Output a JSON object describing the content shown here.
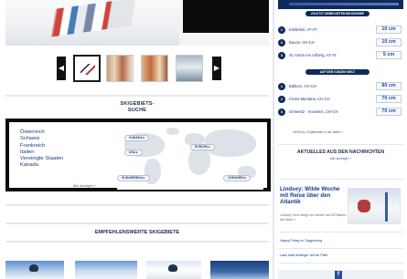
{
  "carousel": {
    "prev_label": "◀",
    "next_label": "▶"
  },
  "ski_search": {
    "title_line1": "SKIGEBIETS-",
    "title_line2": "SUCHE",
    "countries": [
      "Österreich",
      "Schweiz",
      "Frankreich",
      "Italien",
      "Vereinigte Staaten",
      "Kanada"
    ],
    "show_all": "Alle anzeigen »",
    "regions": {
      "kanada": "KANADA ▸",
      "usa": "USA ▸",
      "europa": "EUROPA ▸",
      "suedamerika": "SÜDAMERIKA ▸",
      "ozeanien": "OZEANIEN ▸"
    }
  },
  "recommended": {
    "title": "EMPFEHLENSWERTE SKIGEBIETE"
  },
  "snow_ranking": {
    "section1_title": "ZULETZT GEMELDETER NEUSCHNEE",
    "section2_title": "AUF DEM GANZEN WELT",
    "rows": [
      {
        "rank": "1",
        "name": "Kitzbühel, AT-AT",
        "value": "10 cm"
      },
      {
        "rank": "2",
        "name": "Davos, CH-CH",
        "value": "10 cm"
      },
      {
        "rank": "3",
        "name": "St. Anton Am Arlberg, AT-AT",
        "value": "5 cm"
      },
      {
        "rank": "1",
        "name": "Balkorn, CH-CH",
        "value": "80 cm"
      },
      {
        "rank": "2",
        "name": "Crans-Montana, CH-CH",
        "value": "70 cm"
      },
      {
        "rank": "3",
        "name": "Grimentz - Anniviers, CH-CH",
        "value": "70 cm"
      }
    ],
    "view_all": "VIEW ALL Ergebnisse in der Nähe »"
  },
  "news": {
    "title": "AKTUELLES AUS DEN NACHRICHTEN",
    "subtitle": "Alle anzeigen »",
    "headline": "Lindsey: Wilde Woche mit Reise über den Atlantik",
    "body": "Lindsey Vonn steigt nur wieder auf DITNatürs die Wahl »",
    "links": [
      "Happy Friday on Toggenburg",
      "Laax lockt Anfänger auf die Piste"
    ]
  },
  "social": {
    "facebook_label": "f"
  },
  "colors": {
    "navy": "#0f2a5a",
    "link_blue": "#1a4ea8",
    "box_border": "#0d0d0d"
  }
}
